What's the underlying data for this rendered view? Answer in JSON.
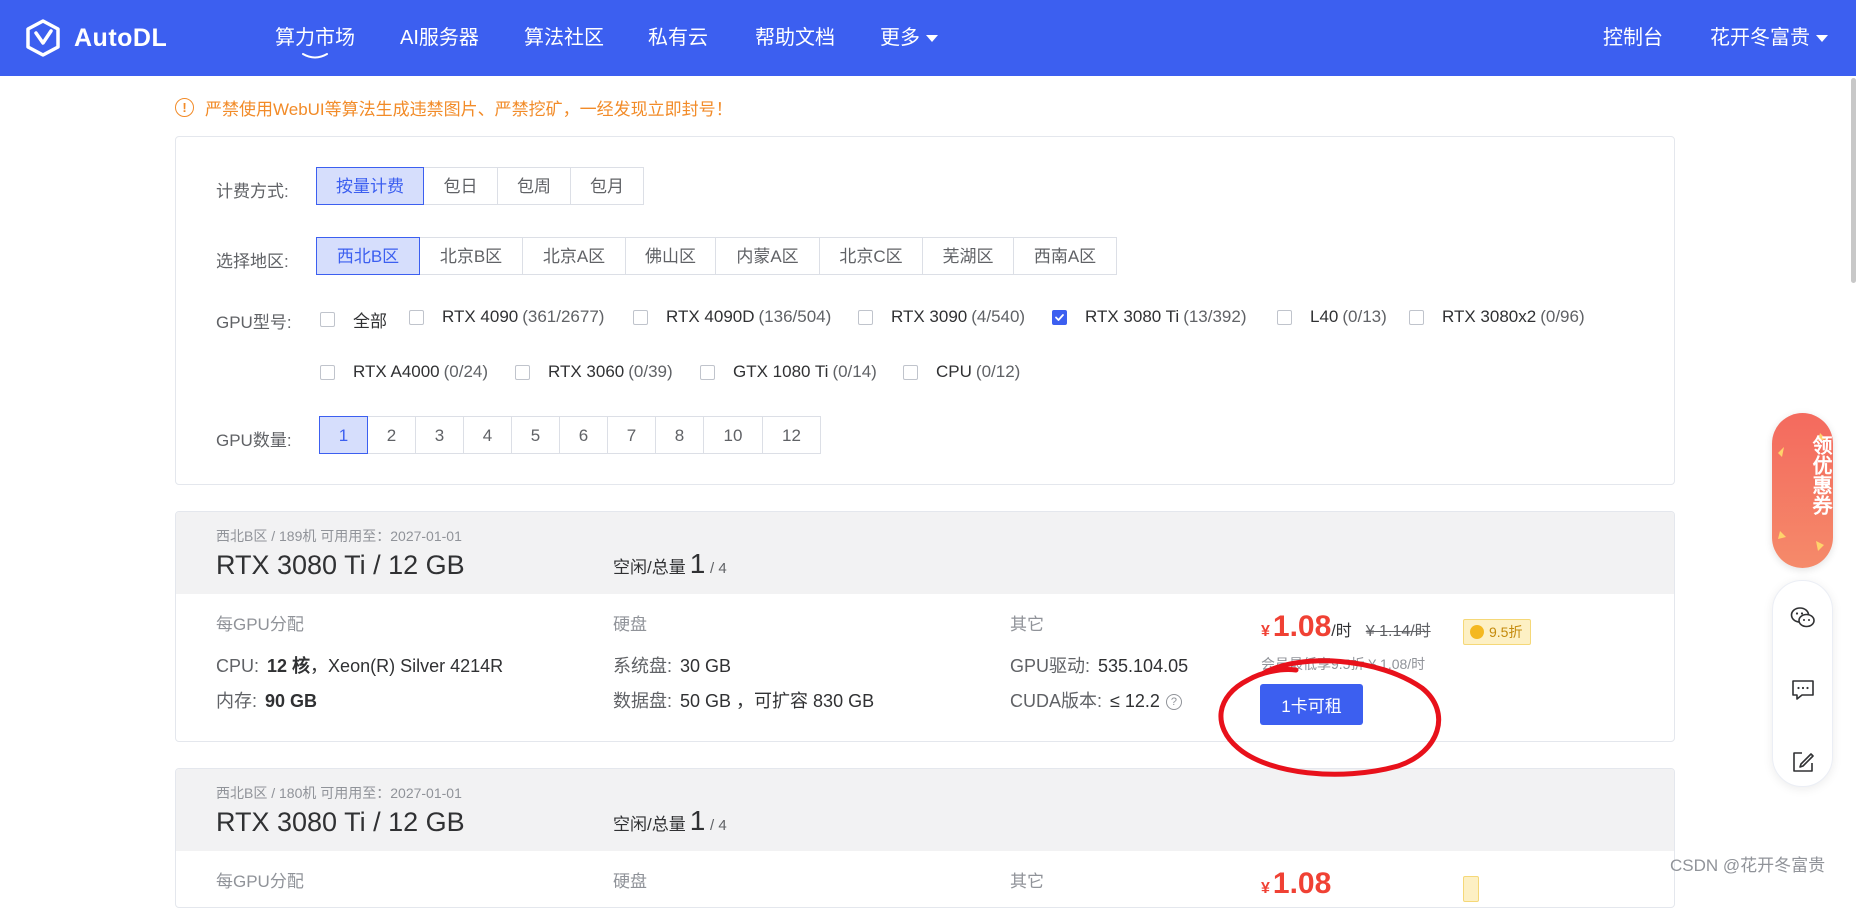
{
  "nav": {
    "logo_text": "AutoDL",
    "items": [
      {
        "label": "算力市场"
      },
      {
        "label": "AI服务器"
      },
      {
        "label": "算法社区"
      },
      {
        "label": "私有云"
      },
      {
        "label": "帮助文档"
      },
      {
        "label": "更多"
      }
    ],
    "console": "控制台",
    "user": "花开冬富贵",
    "brand_color": "#3c5ff0"
  },
  "warning": {
    "icon": "exclamation-circle-icon",
    "text": "严禁使用WebUI等算法生成违禁图片、严禁挖矿，一经发现立即封号！"
  },
  "filters": {
    "billing": {
      "label": "计费方式:",
      "options": [
        "按量计费",
        "包日",
        "包周",
        "包月"
      ],
      "selected": "按量计费"
    },
    "region": {
      "label": "选择地区:",
      "options": [
        "西北B区",
        "北京B区",
        "北京A区",
        "佛山区",
        "内蒙A区",
        "北京C区",
        "芜湖区",
        "西南A区"
      ],
      "selected": "西北B区"
    },
    "gpu_type": {
      "label": "GPU型号:",
      "options": [
        {
          "name": "全部",
          "count": "",
          "checked": false
        },
        {
          "name": "RTX 4090",
          "count": "(361/2677)",
          "checked": false
        },
        {
          "name": "RTX 4090D",
          "count": "(136/504)",
          "checked": false
        },
        {
          "name": "RTX 3090",
          "count": "(4/540)",
          "checked": false
        },
        {
          "name": "RTX 3080 Ti",
          "count": "(13/392)",
          "checked": true
        },
        {
          "name": "L40",
          "count": "(0/13)",
          "checked": false
        },
        {
          "name": "RTX 3080x2",
          "count": "(0/96)",
          "checked": false
        },
        {
          "name": "RTX A4000",
          "count": "(0/24)",
          "checked": false
        },
        {
          "name": "RTX 3060",
          "count": "(0/39)",
          "checked": false
        },
        {
          "name": "GTX 1080 Ti",
          "count": "(0/14)",
          "checked": false
        },
        {
          "name": "CPU",
          "count": "(0/12)",
          "checked": false
        }
      ]
    },
    "gpu_count": {
      "label": "GPU数量:",
      "options": [
        "1",
        "2",
        "3",
        "4",
        "5",
        "6",
        "7",
        "8",
        "10",
        "12"
      ],
      "selected": "1"
    }
  },
  "machines": [
    {
      "meta": "西北B区 / 189机   可用用至：2027-01-01",
      "title": "RTX 3080 Ti / 12 GB",
      "idle_label": "空闲/总量",
      "idle": "1",
      "total": "/ 4",
      "alloc_header": "每GPU分配",
      "cpu_label": "CPU:",
      "cpu_cores": "12 核",
      "cpu_model": "，Xeon(R) Silver 4214R",
      "mem_label": "内存:",
      "mem_value": "90 GB",
      "disk_header": "硬盘",
      "sys_disk_label": "系统盘:",
      "sys_disk_value": "30 GB",
      "data_disk_label": "数据盘:",
      "data_disk_value": "50 GB ，可扩容 830 GB",
      "other_header": "其它",
      "driver_label": "GPU驱动:",
      "driver_value": "535.104.05",
      "cuda_label": "CUDA版本:",
      "cuda_value": "≤ 12.2",
      "currency": "¥",
      "price": "1.08",
      "price_unit": "/时",
      "orig_price": "¥ 1.14/时",
      "discount": "9.5折",
      "price_note": "会员最低享9.5折 ¥ 1.08/时",
      "rent_label": "1卡可租"
    },
    {
      "meta": "西北B区 / 180机   可用用至：2027-01-01",
      "title": "RTX 3080 Ti / 12 GB",
      "idle_label": "空闲/总量",
      "idle": "1",
      "total": "/ 4",
      "alloc_header": "每GPU分配",
      "disk_header": "硬盘",
      "other_header": "其它",
      "currency": "¥",
      "price": "1.08"
    }
  ],
  "sidebar": {
    "coupon_text": "领优惠券"
  },
  "watermark": "CSDN @花开冬富贵",
  "annotation_color": "#e8111b"
}
